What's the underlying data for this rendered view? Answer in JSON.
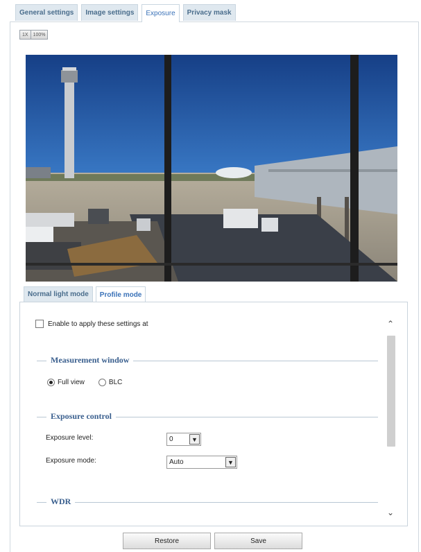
{
  "top_tabs": [
    {
      "label": "General settings"
    },
    {
      "label": "Image settings"
    },
    {
      "label": "Exposure"
    },
    {
      "label": "Privacy mask"
    }
  ],
  "zoom": {
    "zoom_1x": "1X",
    "zoom_100": "100%"
  },
  "mode_tabs": [
    {
      "label": "Normal light mode"
    },
    {
      "label": "Profile mode"
    }
  ],
  "enable_label": "Enable to apply these settings at",
  "measurement": {
    "title": "Measurement window",
    "options": [
      "Full view",
      "BLC"
    ],
    "selected": "Full view"
  },
  "exposure": {
    "title": "Exposure control",
    "level_label": "Exposure level:",
    "level_value": "0",
    "mode_label": "Exposure mode:",
    "mode_value": "Auto"
  },
  "wdr": {
    "title": "WDR"
  },
  "buttons": {
    "restore": "Restore",
    "save": "Save"
  },
  "colors": {
    "accent": "#3a72b8",
    "tab_bg": "#dfe8ef",
    "section_title": "#3a5f8e"
  }
}
